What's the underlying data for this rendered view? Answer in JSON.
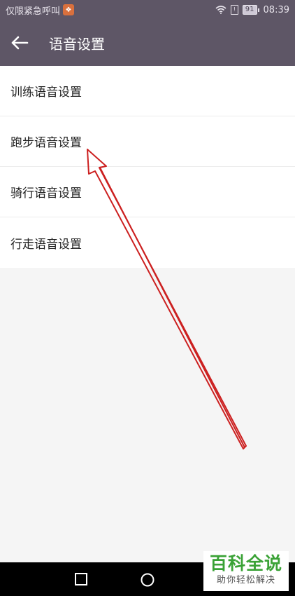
{
  "status_bar": {
    "left_text": "仅限紧急呼叫",
    "app_icon": "app-notification-icon",
    "battery": "91",
    "time": "08:39"
  },
  "header": {
    "back_icon": "back-arrow-icon",
    "title": "语音设置"
  },
  "settings_list": {
    "items": [
      {
        "label": "训练语音设置"
      },
      {
        "label": "跑步语音设置"
      },
      {
        "label": "骑行语音设置"
      },
      {
        "label": "行走语音设置"
      }
    ]
  },
  "annotation": {
    "color": "#cc2020",
    "target": "跑步语音设置"
  },
  "nav_bar": {
    "recents_icon": "square-recents-icon",
    "home_icon": "circle-home-icon"
  },
  "watermark": {
    "title": "百科全说",
    "subtitle": "助你轻松解决",
    "color": "#3aa236"
  }
}
